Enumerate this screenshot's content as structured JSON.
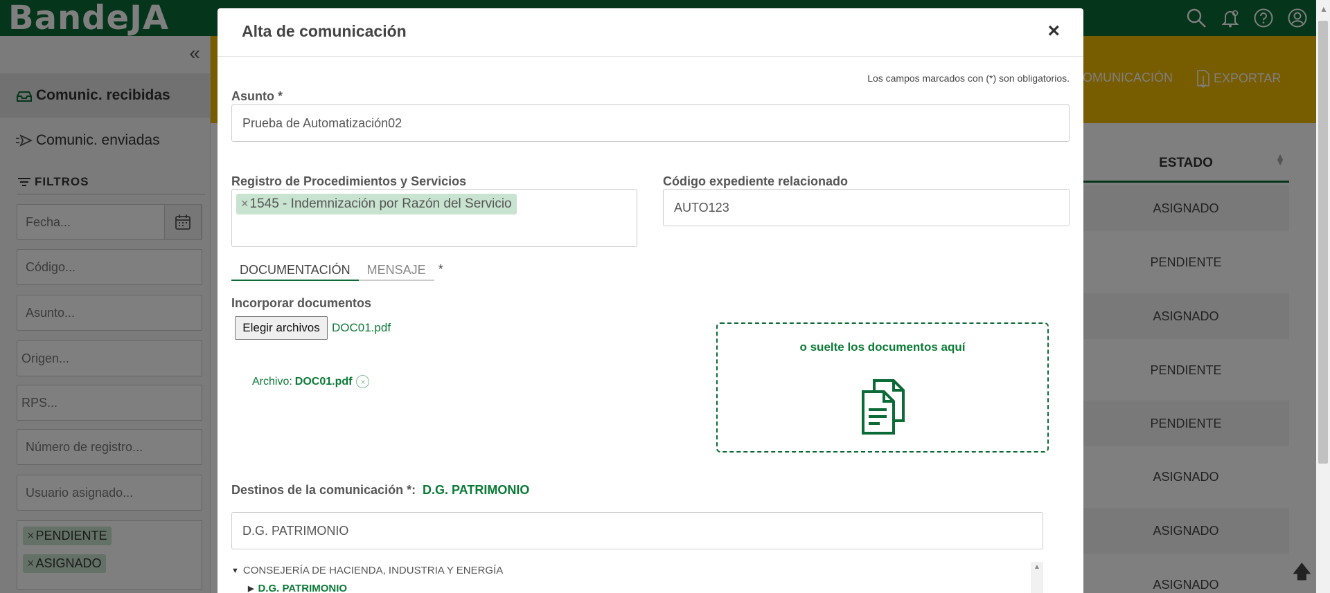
{
  "app": {
    "logo": "BandeJA"
  },
  "sidebar": {
    "received": "Comunic. recibidas",
    "sent": "Comunic. enviadas",
    "filters_title": "FILTROS",
    "filters": {
      "fecha": "Fecha...",
      "codigo": "Código...",
      "asunto": "Asunto...",
      "origen": "Origen...",
      "rps": "RPS...",
      "numero": "Número de registro...",
      "usuario": "Usuario asignado..."
    },
    "state_tags": [
      "PENDIENTE",
      "ASIGNADO"
    ]
  },
  "toolbar": {
    "new_comm": "OMUNICACIÓN",
    "export": "EXPORTAR"
  },
  "table": {
    "estado_header": "ESTADO",
    "rows": [
      "ASIGNADO",
      "PENDIENTE",
      "ASIGNADO",
      "PENDIENTE",
      "PENDIENTE",
      "ASIGNADO",
      "ASIGNADO",
      "ASIGNADO"
    ]
  },
  "modal": {
    "title": "Alta de comunicación",
    "close": "×",
    "required_note": "Los campos marcados con (*) son obligatorios.",
    "asunto_label": "Asunto *",
    "asunto_value": "Prueba de Automatización02",
    "rps_label": "Registro de Procedimientos y Servicios",
    "rps_tag": "1545 - Indemnización por Razón del Servicio",
    "codigo_label": "Código expediente relacionado",
    "codigo_value": "AUTO123",
    "tabs": [
      "DOCUMENTACIÓN",
      "MENSAJE"
    ],
    "tab_required": "*",
    "incorporar_label": "Incorporar documentos",
    "choose_files": "Elegir archivos",
    "chosen_file": "DOC01.pdf",
    "archivo_label": "Archivo:",
    "archivo_name": "DOC01.pdf",
    "drop_text": "o suelte los documentos aquí",
    "dest_label": "Destinos de la comunicación *:",
    "dest_value": "D.G. PATRIMONIO",
    "dest_input": "D.G. PATRIMONIO",
    "tree": {
      "parent": "CONSEJERÍA DE HACIENDA, INDUSTRIA Y ENERGÍA",
      "child": "D.G. PATRIMONIO"
    }
  },
  "colors": {
    "brand_green": "#0b6a36",
    "accent_yellow": "#f0b800",
    "tag_green": "#c8e3cf"
  }
}
